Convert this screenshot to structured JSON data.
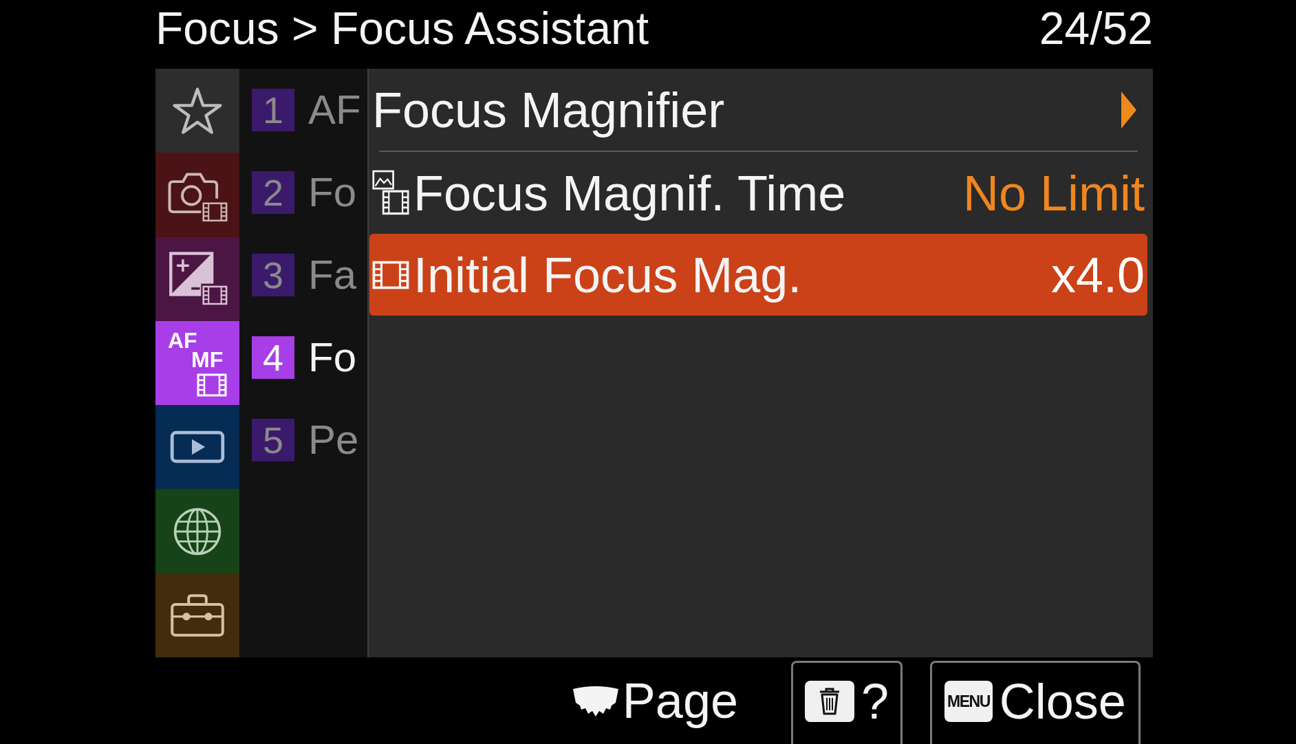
{
  "header": {
    "breadcrumb": {
      "parent": "Focus",
      "separator": ">",
      "current": "Focus Assistant"
    },
    "page_counter": "24/52"
  },
  "tabs": [
    {
      "kind": "favorites",
      "color": "#2d2d2d",
      "selected": false
    },
    {
      "kind": "camera_movie",
      "color": "#4b1315",
      "selected": false
    },
    {
      "kind": "exposure_movie",
      "color": "#4c1644",
      "selected": false
    },
    {
      "kind": "af_mf",
      "color": "#a83ee8",
      "selected": true,
      "label_top": "AF",
      "label_bottom": "MF"
    },
    {
      "kind": "playback",
      "color": "#062b54",
      "selected": false
    },
    {
      "kind": "network",
      "color": "#174318",
      "selected": false
    },
    {
      "kind": "setup",
      "color": "#432c0d",
      "selected": false
    }
  ],
  "pages": [
    {
      "number": "1",
      "title": "AF",
      "selected": false
    },
    {
      "number": "2",
      "title": "Fo",
      "selected": false
    },
    {
      "number": "3",
      "title": "Fa",
      "selected": false
    },
    {
      "number": "4",
      "title": "Fo",
      "selected": true
    },
    {
      "number": "5",
      "title": "Pe",
      "selected": false
    }
  ],
  "items": [
    {
      "kind": "submenu",
      "label": "Focus Magnifier",
      "selected": false
    },
    {
      "kind": "photo_movie",
      "label": "Focus Magnif. Time",
      "value": "No Limit",
      "selected": false
    },
    {
      "kind": "movie",
      "label": "Initial Focus Mag.",
      "value": "x4.0",
      "selected": true
    }
  ],
  "footer": {
    "page_hint": "Page",
    "buttons": [
      {
        "kind": "delete_help",
        "label": "?"
      },
      {
        "kind": "menu_close",
        "key": "MENU",
        "label": "Close"
      }
    ]
  }
}
